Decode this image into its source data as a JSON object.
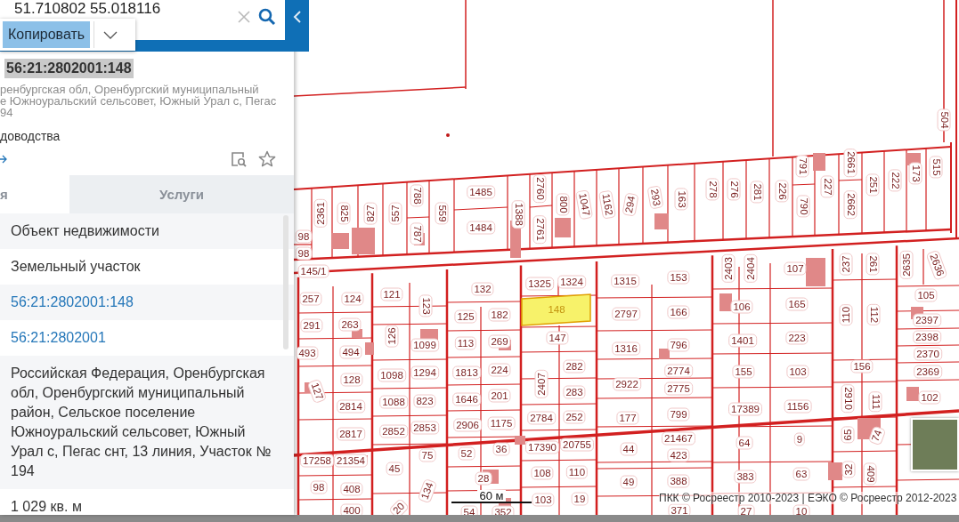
{
  "search": {
    "value": "51.710802 55.018116"
  },
  "copy_popup": {
    "button": "Копировать"
  },
  "card": {
    "cadastral_number": "56:21:2802001:148",
    "address_lines": [
      "ренбургская обл, Оренбургский муниципальный",
      "е Южноуральский сельсовет, Южный Урал с, Пегас",
      "94"
    ],
    "usage": "доводства"
  },
  "tabs": [
    {
      "label": "я",
      "selected": true
    },
    {
      "label": "Услуги",
      "selected": false
    }
  ],
  "details": [
    {
      "kind": "text",
      "text": "Объект недвижимости"
    },
    {
      "kind": "text",
      "text": "Земельный участок"
    },
    {
      "kind": "link",
      "text": "56:21:2802001:148"
    },
    {
      "kind": "link",
      "text": "56:21:2802001"
    },
    {
      "kind": "text",
      "text": "Российская Федерация, Оренбургская обл, Оренбургский муниципальный район, Сельское поселение Южноуральский сельсовет, Южный Урал с, Пегас снт, 13 линия, Участок № 194"
    },
    {
      "kind": "text",
      "text": "1 029 кв. м"
    }
  ],
  "map": {
    "parcel_labels": [
      "2361",
      "825",
      "827",
      "557",
      "788",
      "787",
      "559",
      "1485",
      "1484",
      "1388",
      "2760",
      "2761",
      "800",
      "1047",
      "1162",
      "294",
      "293",
      "163",
      "278",
      "276",
      "281",
      "226",
      "791",
      "790",
      "227",
      "2661",
      "2662",
      "251",
      "222",
      "173",
      "515",
      "504",
      "98",
      "98",
      "145/1",
      "257",
      "124",
      "121",
      "123",
      "132",
      "1325",
      "1324",
      "1315",
      "153",
      "2403",
      "2404",
      "107",
      "237",
      "261",
      "2635",
      "2636",
      "291",
      "263",
      "126",
      "125",
      "182",
      "2797",
      "166",
      "106",
      "165",
      "110",
      "112",
      "105",
      "2397",
      "2398",
      "2370",
      "2369",
      "102",
      "493",
      "494",
      "1099",
      "113",
      "269",
      "147",
      "1316",
      "796",
      "1401",
      "223",
      "156",
      "128",
      "127",
      "1098",
      "1294",
      "1813",
      "224",
      "2407",
      "282",
      "2922",
      "2774",
      "2775",
      "155",
      "103",
      "2910",
      "111",
      "2814",
      "1088",
      "823",
      "1646",
      "201",
      "283",
      "177",
      "799",
      "17389",
      "1156",
      "2817",
      "2852",
      "2853",
      "2906",
      "1175",
      "2784",
      "252",
      "17258",
      "21354",
      "75",
      "52",
      "36",
      "17390",
      "20755",
      "44",
      "21467",
      "423",
      "64",
      "9",
      "65",
      "74",
      "98",
      "45",
      "408",
      "28",
      "108",
      "110",
      "49",
      "388",
      "383",
      "63",
      "32",
      "409",
      "134",
      "20",
      "400",
      "54",
      "352",
      "103",
      "19",
      "371",
      "27",
      "10"
    ],
    "selected_parcel": {
      "label": "148"
    },
    "scale": "60 м",
    "attribution": "ПКК © Росреестр 2010-2023 | ЕЭКО © Росреестр 2012-2023"
  }
}
